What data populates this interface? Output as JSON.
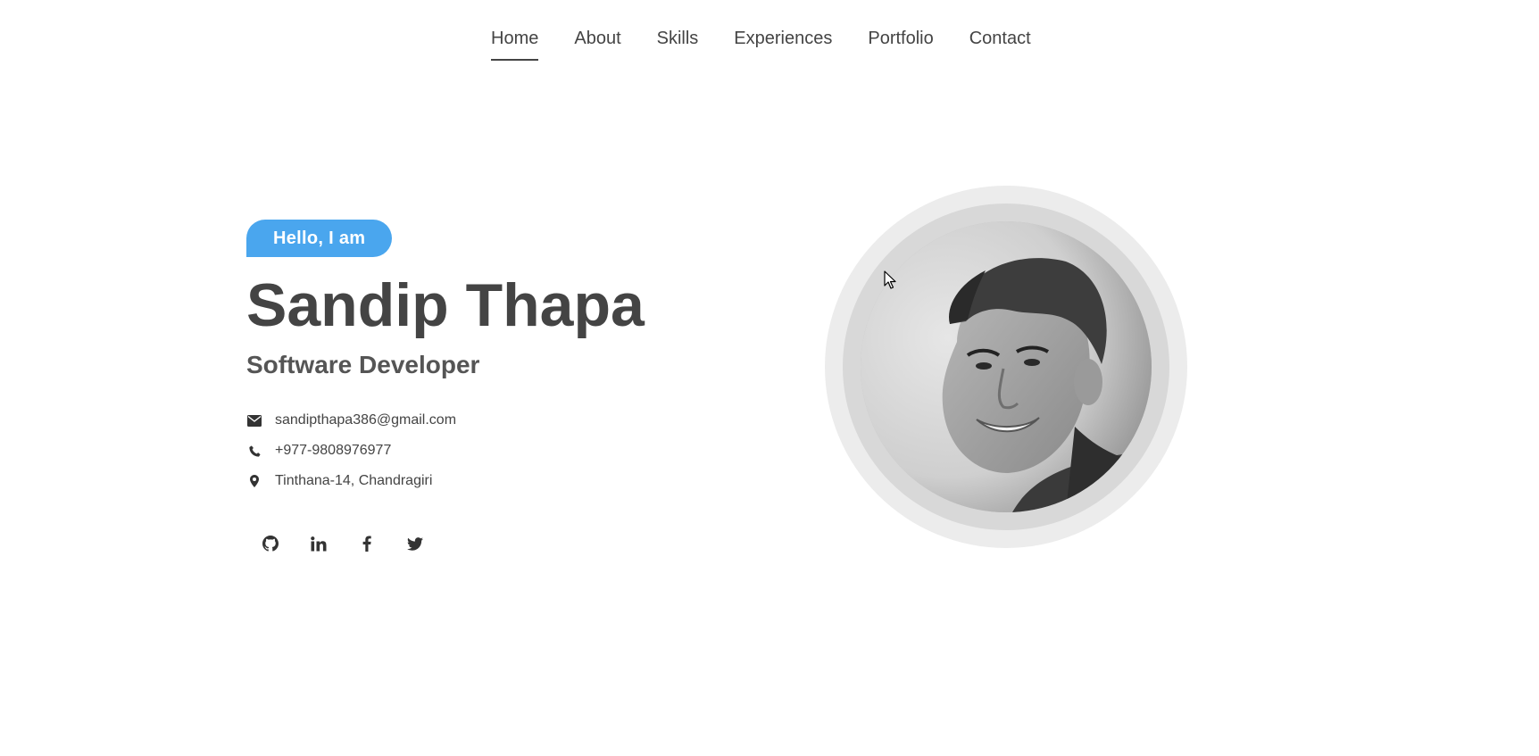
{
  "nav": {
    "items": [
      {
        "label": "Home",
        "active": true
      },
      {
        "label": "About",
        "active": false
      },
      {
        "label": "Skills",
        "active": false
      },
      {
        "label": "Experiences",
        "active": false
      },
      {
        "label": "Portfolio",
        "active": false
      },
      {
        "label": "Contact",
        "active": false
      }
    ]
  },
  "hero": {
    "greeting": "Hello, I am",
    "name": "Sandip Thapa",
    "title": "Software Developer",
    "contacts": {
      "email": {
        "icon": "envelope-icon",
        "text": "sandipthapa386@gmail.com"
      },
      "phone": {
        "icon": "phone-icon",
        "text": "+977-9808976977"
      },
      "location": {
        "icon": "map-marker-icon",
        "text": "Tinthana-14, Chandragiri"
      }
    },
    "socials": [
      {
        "name": "github",
        "icon": "github-icon"
      },
      {
        "name": "linkedin",
        "icon": "linkedin-icon"
      },
      {
        "name": "facebook",
        "icon": "facebook-icon"
      },
      {
        "name": "twitter",
        "icon": "twitter-icon"
      }
    ]
  },
  "colors": {
    "accent": "#4aa6ee",
    "text": "#444444",
    "ring_outer": "#ececec",
    "ring_inner": "#d8d8d8"
  }
}
